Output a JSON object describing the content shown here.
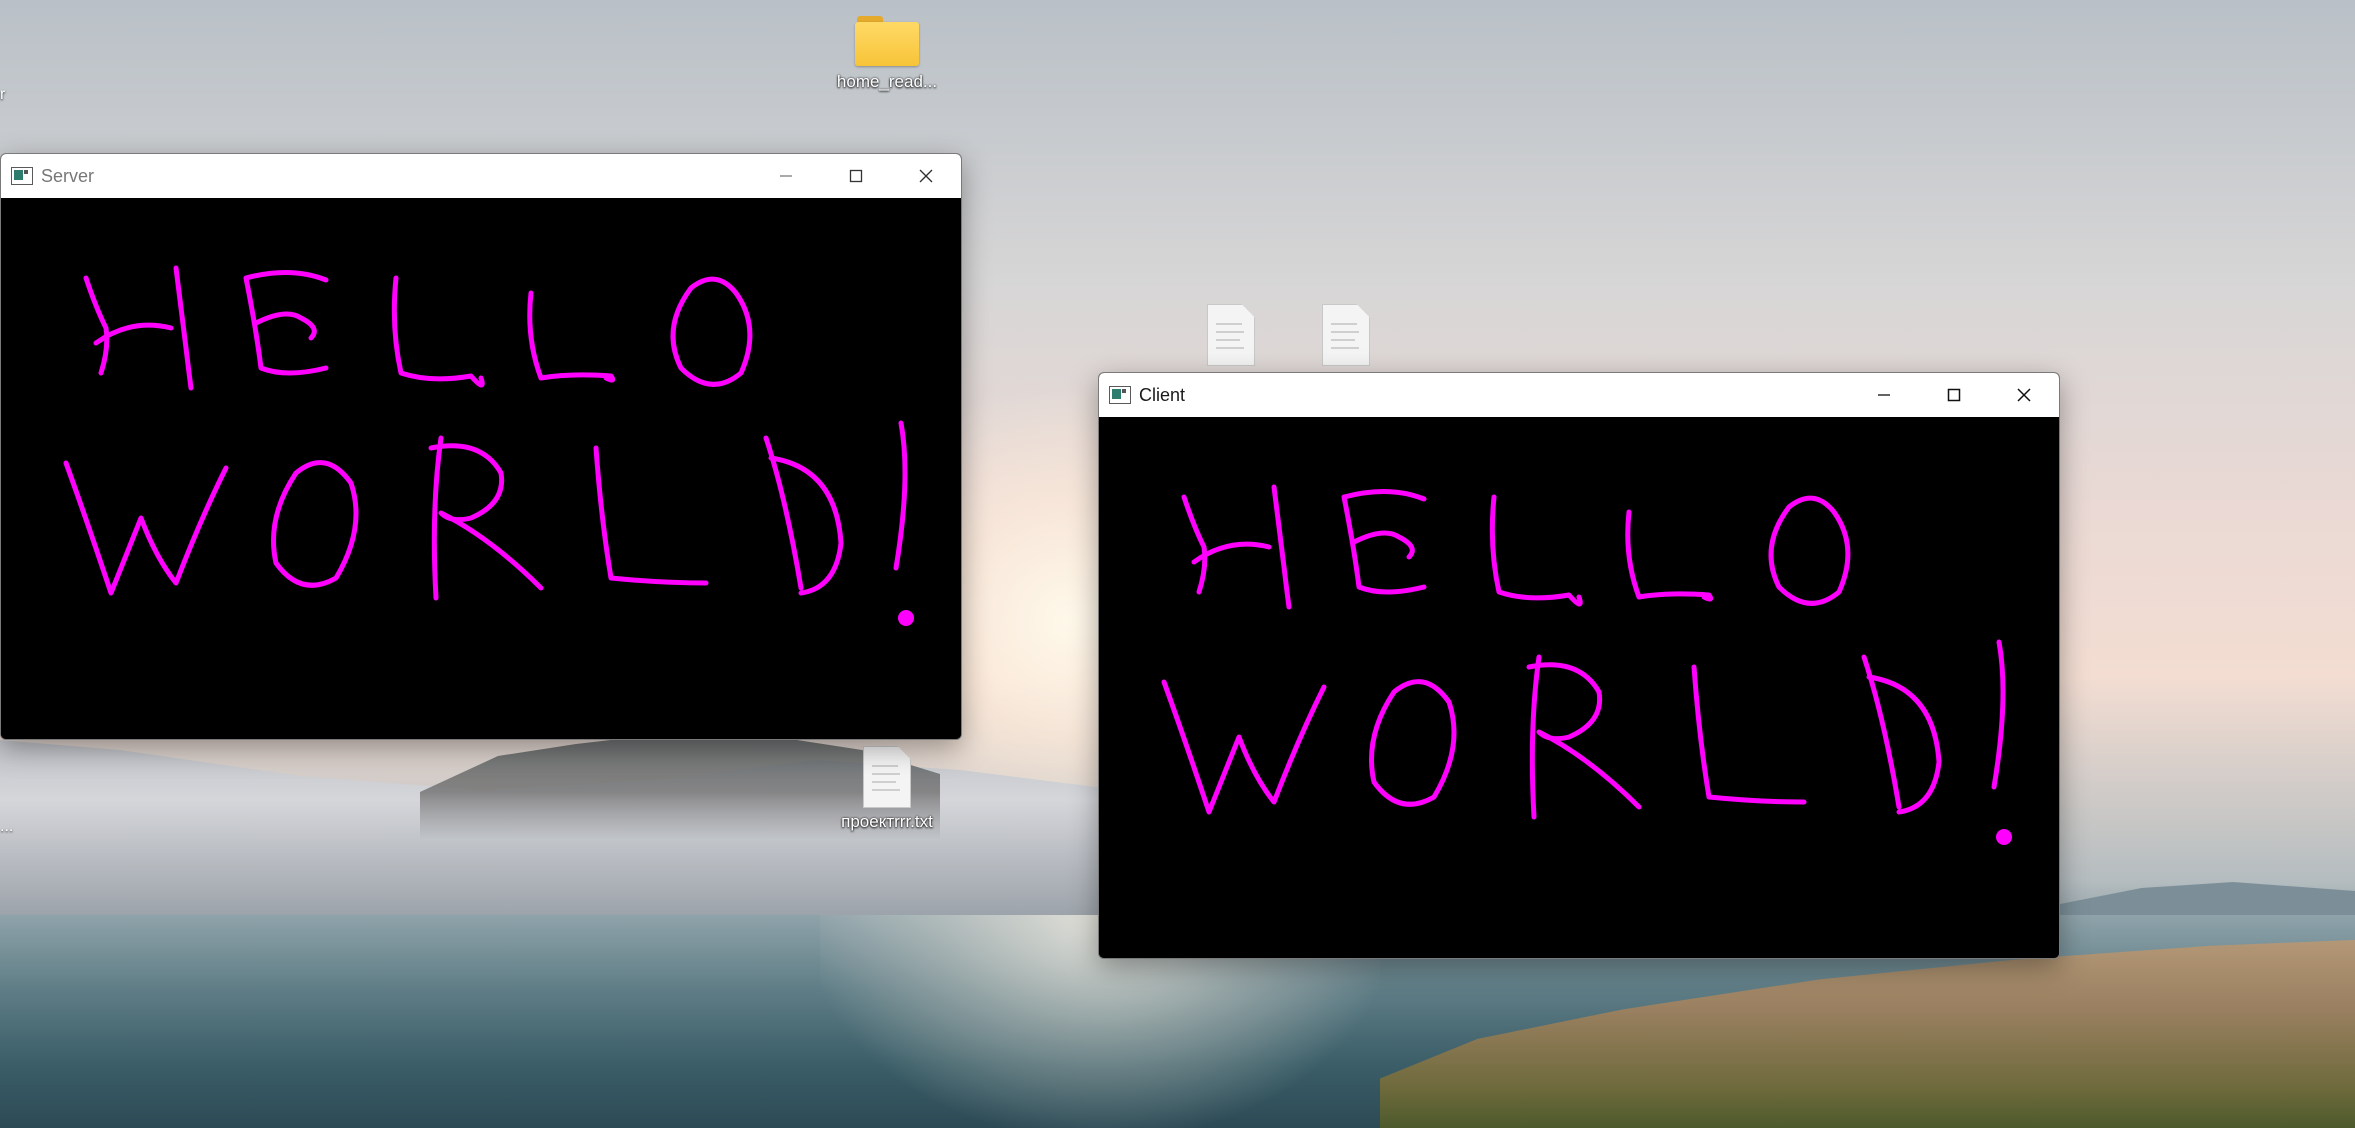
{
  "desktop": {
    "icons": [
      {
        "label": "home_read...",
        "icon": "folder-icon"
      },
      {
        "label": "",
        "icon": "text-file-icon"
      },
      {
        "label": "",
        "icon": "text-file-icon"
      },
      {
        "label": "проектrrr.txt",
        "icon": "text-file-icon"
      }
    ],
    "edge_fragments": [
      "r",
      "..."
    ]
  },
  "windows": [
    {
      "title": "Server",
      "icon": "app-window-icon",
      "controls": [
        "minimize-icon",
        "maximize-icon",
        "close-icon"
      ],
      "canvas": {
        "background": "#000000",
        "stroke_color": "#ff00ff",
        "drawing_text": "HELLO WORLD!"
      }
    },
    {
      "title": "Client",
      "icon": "app-window-icon",
      "controls": [
        "minimize-icon",
        "maximize-icon",
        "close-icon"
      ],
      "canvas": {
        "background": "#000000",
        "stroke_color": "#ff00ff",
        "drawing_text": "HELLO WORLD!"
      }
    }
  ]
}
